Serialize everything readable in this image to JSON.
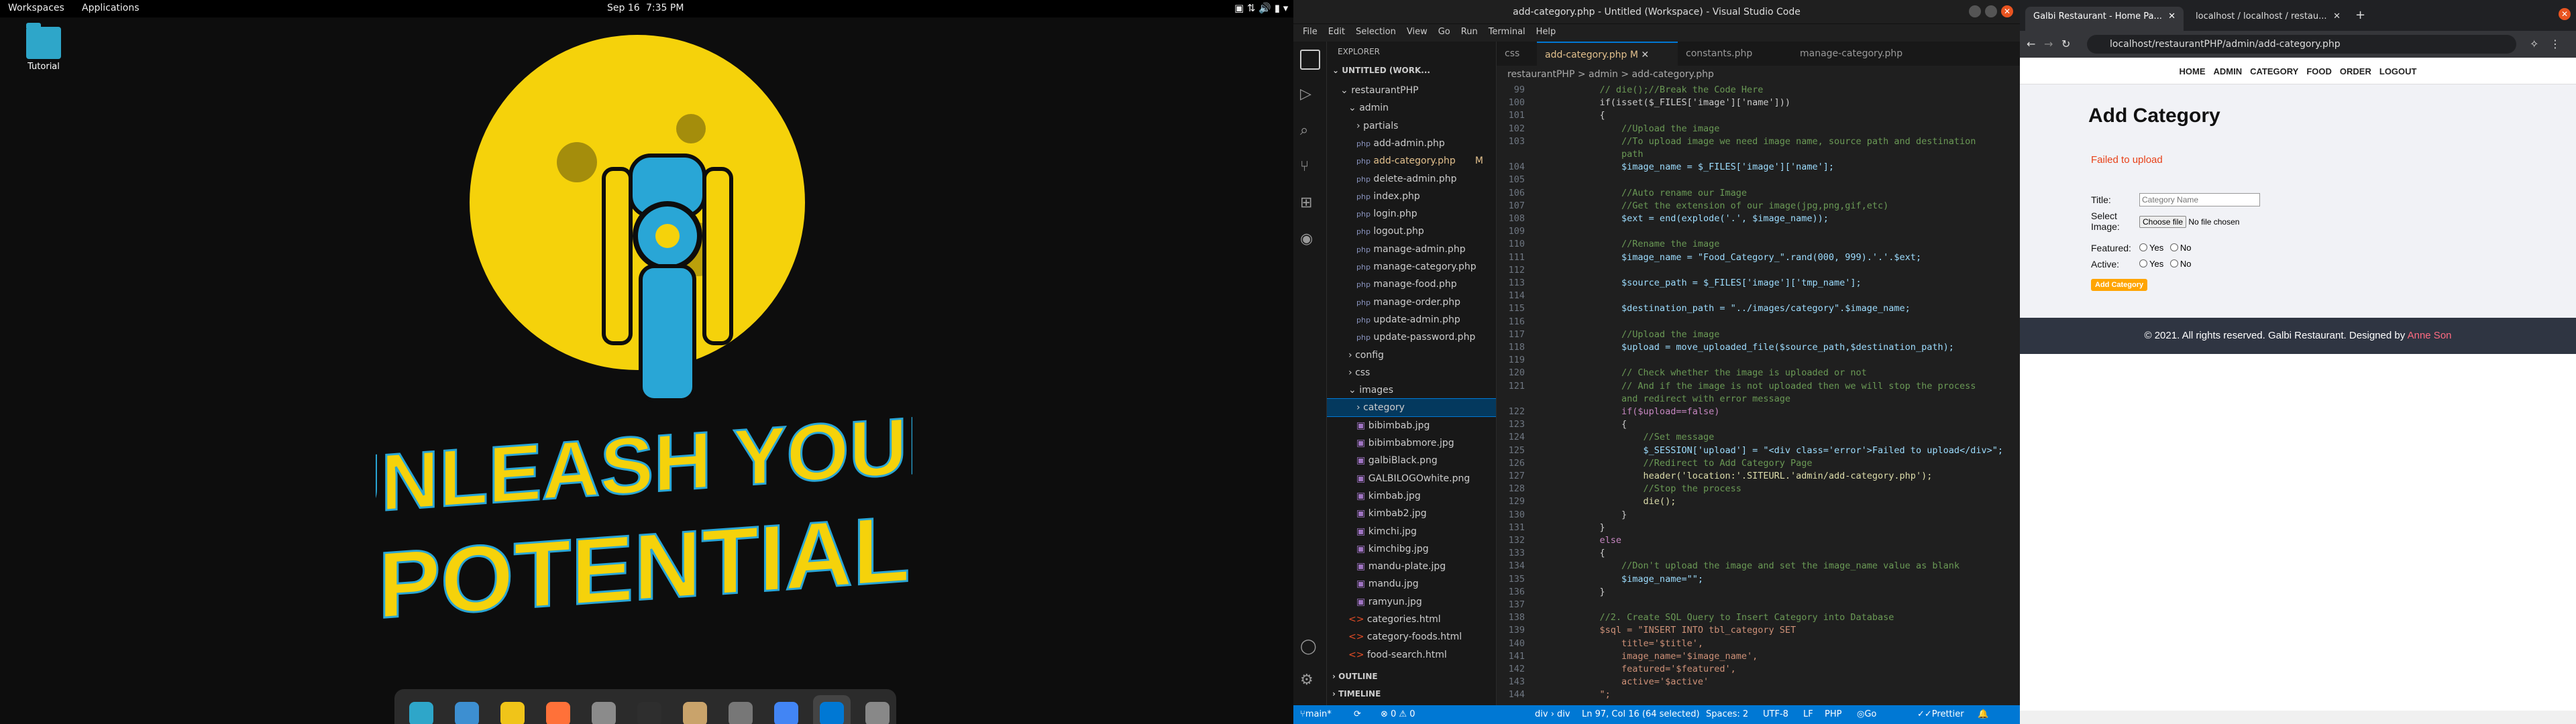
{
  "topbar": {
    "workspaces": "Workspaces",
    "applications": "Applications",
    "date": "Sep 16",
    "time": "7:35 PM"
  },
  "desktop": {
    "icon_label": "Tutorial",
    "wallpaper": {
      "line1": "UNLEASH YOUR",
      "line2": "POTENTIAL",
      "color": "#f5d20b",
      "accent": "#29a6d6"
    },
    "dock_items": [
      "search-app-icon",
      "files-icon",
      "apps-grid-icon",
      "firefox-icon",
      "file-manager-icon",
      "terminal-icon",
      "archive-icon",
      "settings-icon",
      "chrome-icon",
      "vscode-icon",
      "usb-icon"
    ]
  },
  "vscode": {
    "title": "add-category.php - Untitled (Workspace) - Visual Studio Code",
    "menu": [
      "File",
      "Edit",
      "Selection",
      "View",
      "Go",
      "Run",
      "Terminal",
      "Help"
    ],
    "explorer_title": "EXPLORER",
    "workspace": "UNTITLED (WORK...",
    "tree": [
      {
        "label": "restaurantPHP",
        "indent": 1,
        "kind": "folder-open"
      },
      {
        "label": "admin",
        "indent": 2,
        "kind": "folder-open"
      },
      {
        "label": "partials",
        "indent": 3,
        "kind": "folder"
      },
      {
        "label": "add-admin.php",
        "indent": 3,
        "kind": "php"
      },
      {
        "label": "add-category.php",
        "indent": 3,
        "kind": "php",
        "mod": "M"
      },
      {
        "label": "delete-admin.php",
        "indent": 3,
        "kind": "php"
      },
      {
        "label": "index.php",
        "indent": 3,
        "kind": "php"
      },
      {
        "label": "login.php",
        "indent": 3,
        "kind": "php"
      },
      {
        "label": "logout.php",
        "indent": 3,
        "kind": "php"
      },
      {
        "label": "manage-admin.php",
        "indent": 3,
        "kind": "php"
      },
      {
        "label": "manage-category.php",
        "indent": 3,
        "kind": "php"
      },
      {
        "label": "manage-food.php",
        "indent": 3,
        "kind": "php"
      },
      {
        "label": "manage-order.php",
        "indent": 3,
        "kind": "php"
      },
      {
        "label": "update-admin.php",
        "indent": 3,
        "kind": "php"
      },
      {
        "label": "update-password.php",
        "indent": 3,
        "kind": "php"
      },
      {
        "label": "config",
        "indent": 2,
        "kind": "folder"
      },
      {
        "label": "css",
        "indent": 2,
        "kind": "folder"
      },
      {
        "label": "images",
        "indent": 2,
        "kind": "folder-open"
      },
      {
        "label": "category",
        "indent": 3,
        "kind": "folder",
        "selected": true
      },
      {
        "label": "bibimbab.jpg",
        "indent": 3,
        "kind": "img"
      },
      {
        "label": "bibimbabmore.jpg",
        "indent": 3,
        "kind": "img"
      },
      {
        "label": "galbiBlack.png",
        "indent": 3,
        "kind": "img"
      },
      {
        "label": "GALBILOGOwhite.png",
        "indent": 3,
        "kind": "img"
      },
      {
        "label": "kimbab.jpg",
        "indent": 3,
        "kind": "img"
      },
      {
        "label": "kimbab2.jpg",
        "indent": 3,
        "kind": "img"
      },
      {
        "label": "kimchi.jpg",
        "indent": 3,
        "kind": "img"
      },
      {
        "label": "kimchibg.jpg",
        "indent": 3,
        "kind": "img"
      },
      {
        "label": "mandu-plate.jpg",
        "indent": 3,
        "kind": "img"
      },
      {
        "label": "mandu.jpg",
        "indent": 3,
        "kind": "img"
      },
      {
        "label": "ramyun.jpg",
        "indent": 3,
        "kind": "img"
      },
      {
        "label": "categories.html",
        "indent": 2,
        "kind": "html"
      },
      {
        "label": "category-foods.html",
        "indent": 2,
        "kind": "html"
      },
      {
        "label": "food-search.html",
        "indent": 2,
        "kind": "html"
      }
    ],
    "outline": "OUTLINE",
    "timeline": "TIMELINE",
    "tabs": [
      {
        "label": "css",
        "active": false
      },
      {
        "label": "add-category.php M",
        "active": true
      },
      {
        "label": "constants.php",
        "active": false
      },
      {
        "label": "manage-category.php",
        "active": false
      }
    ],
    "breadcrumb": "restaurantPHP > admin > add-category.php",
    "code": [
      {
        "n": "99",
        "t": "            // die();//Break the Code Here",
        "c": "#6a9955"
      },
      {
        "n": "100",
        "t": "            if(isset($_FILES['image']['name']))",
        "c": "#ccc"
      },
      {
        "n": "101",
        "t": "            {",
        "c": "#ccc"
      },
      {
        "n": "102",
        "t": "                //Upload the image",
        "c": "#6a9955"
      },
      {
        "n": "103",
        "t": "                //To upload image we need image name, source path and destination",
        "c": "#6a9955"
      },
      {
        "n": "",
        "t": "                path",
        "c": "#6a9955"
      },
      {
        "n": "104",
        "t": "                $image_name = $_FILES['image']['name'];",
        "c": "#9cdcfe"
      },
      {
        "n": "105",
        "t": "",
        "c": "#ccc"
      },
      {
        "n": "106",
        "t": "                //Auto rename our Image",
        "c": "#6a9955"
      },
      {
        "n": "107",
        "t": "                //Get the extension of our image(jpg,png,gif,etc)",
        "c": "#6a9955"
      },
      {
        "n": "108",
        "t": "                $ext = end(explode('.', $image_name));",
        "c": "#9cdcfe"
      },
      {
        "n": "109",
        "t": "",
        "c": "#ccc"
      },
      {
        "n": "110",
        "t": "                //Rename the image",
        "c": "#6a9955"
      },
      {
        "n": "111",
        "t": "                $image_name = \"Food_Category_\".rand(000, 999).'.'.$ext;",
        "c": "#9cdcfe"
      },
      {
        "n": "112",
        "t": "",
        "c": "#ccc"
      },
      {
        "n": "113",
        "t": "                $source_path = $_FILES['image']['tmp_name'];",
        "c": "#9cdcfe"
      },
      {
        "n": "114",
        "t": "",
        "c": "#ccc"
      },
      {
        "n": "115",
        "t": "                $destination_path = \"../images/category\".$image_name;",
        "c": "#9cdcfe"
      },
      {
        "n": "116",
        "t": "",
        "c": "#ccc"
      },
      {
        "n": "117",
        "t": "                //Upload the image",
        "c": "#6a9955"
      },
      {
        "n": "118",
        "t": "                $upload = move_uploaded_file($source_path,$destination_path);",
        "c": "#9cdcfe"
      },
      {
        "n": "119",
        "t": "",
        "c": "#ccc"
      },
      {
        "n": "120",
        "t": "                // Check whether the image is uploaded or not",
        "c": "#6a9955"
      },
      {
        "n": "121",
        "t": "                // And if the image is not uploaded then we will stop the process",
        "c": "#6a9955"
      },
      {
        "n": "",
        "t": "                and redirect with error message",
        "c": "#6a9955"
      },
      {
        "n": "122",
        "t": "                if($upload==false)",
        "c": "#c586c0"
      },
      {
        "n": "123",
        "t": "                {",
        "c": "#ccc"
      },
      {
        "n": "124",
        "t": "                    //Set message",
        "c": "#6a9955"
      },
      {
        "n": "125",
        "t": "                    $_SESSION['upload'] = \"<div class='error'>Failed to upload</div>\";",
        "c": "#9cdcfe"
      },
      {
        "n": "126",
        "t": "                    //Redirect to Add Category Page",
        "c": "#6a9955"
      },
      {
        "n": "127",
        "t": "                    header('location:'.SITEURL.'admin/add-category.php');",
        "c": "#dcdcaa"
      },
      {
        "n": "128",
        "t": "                    //Stop the process",
        "c": "#6a9955"
      },
      {
        "n": "129",
        "t": "                    die();",
        "c": "#dcdcaa"
      },
      {
        "n": "130",
        "t": "                }",
        "c": "#ccc"
      },
      {
        "n": "131",
        "t": "            }",
        "c": "#ccc"
      },
      {
        "n": "132",
        "t": "            else",
        "c": "#c586c0"
      },
      {
        "n": "133",
        "t": "            {",
        "c": "#ccc"
      },
      {
        "n": "134",
        "t": "                //Don't upload the image and set the image_name value as blank",
        "c": "#6a9955"
      },
      {
        "n": "135",
        "t": "                $image_name=\"\";",
        "c": "#9cdcfe"
      },
      {
        "n": "136",
        "t": "            }",
        "c": "#ccc"
      },
      {
        "n": "137",
        "t": "",
        "c": "#ccc"
      },
      {
        "n": "138",
        "t": "            //2. Create SQL Query to Insert Category into Database",
        "c": "#6a9955"
      },
      {
        "n": "139",
        "t": "            $sql = \"INSERT INTO tbl_category SET",
        "c": "#ce9178"
      },
      {
        "n": "140",
        "t": "                title='$title',",
        "c": "#ce9178"
      },
      {
        "n": "141",
        "t": "                image_name='$image_name',",
        "c": "#ce9178"
      },
      {
        "n": "142",
        "t": "                featured='$featured',",
        "c": "#ce9178"
      },
      {
        "n": "143",
        "t": "                active='$active'",
        "c": "#ce9178"
      },
      {
        "n": "144",
        "t": "            \";",
        "c": "#ce9178"
      }
    ],
    "status": {
      "branch": "main*",
      "problems": "⊗ 0 ⚠ 0",
      "position": "div › div",
      "cursor": "Ln 97, Col 16 (64 selected)",
      "spaces": "Spaces: 2",
      "encoding": "UTF-8",
      "eol": "LF",
      "lang": "PHP",
      "golive": "Go Live",
      "prettier": "Prettier"
    }
  },
  "browser": {
    "tabs": [
      "Galbi Restaurant - Home Pa...",
      "localhost / localhost / restau..."
    ],
    "url": "localhost/restaurantPHP/admin/add-category.php",
    "nav": [
      "HOME",
      "ADMIN",
      "CATEGORY",
      "FOOD",
      "ORDER",
      "LOGOUT"
    ],
    "page_title": "Add Category",
    "error": "Failed to upload",
    "form": {
      "title_label": "Title:",
      "title_placeholder": "Category Name",
      "image_label": "Select Image:",
      "choose_file": "Choose file",
      "no_file": "No file chosen",
      "featured_label": "Featured:",
      "active_label": "Active:",
      "yes": "Yes",
      "no": "No",
      "submit": "Add Category"
    },
    "footer_text": "© 2021. All rights reserved. Galbi Restaurant. Designed by",
    "footer_link": "Anne Son"
  }
}
